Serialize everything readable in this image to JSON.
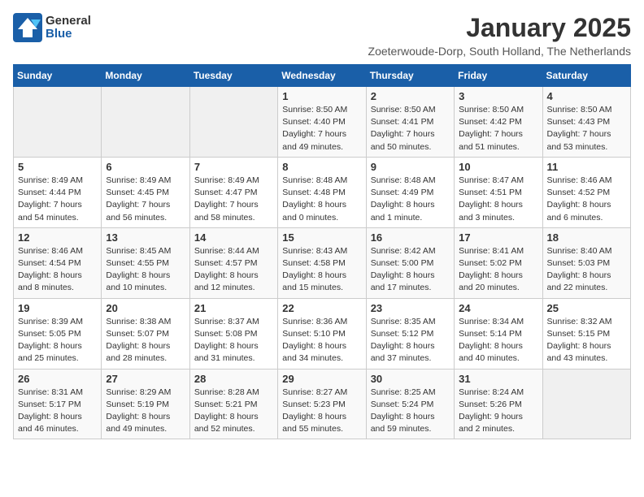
{
  "logo": {
    "general": "General",
    "blue": "Blue"
  },
  "title": "January 2025",
  "location": "Zoeterwoude-Dorp, South Holland, The Netherlands",
  "weekdays": [
    "Sunday",
    "Monday",
    "Tuesday",
    "Wednesday",
    "Thursday",
    "Friday",
    "Saturday"
  ],
  "weeks": [
    [
      {
        "day": "",
        "info": ""
      },
      {
        "day": "",
        "info": ""
      },
      {
        "day": "",
        "info": ""
      },
      {
        "day": "1",
        "info": "Sunrise: 8:50 AM\nSunset: 4:40 PM\nDaylight: 7 hours and 49 minutes."
      },
      {
        "day": "2",
        "info": "Sunrise: 8:50 AM\nSunset: 4:41 PM\nDaylight: 7 hours and 50 minutes."
      },
      {
        "day": "3",
        "info": "Sunrise: 8:50 AM\nSunset: 4:42 PM\nDaylight: 7 hours and 51 minutes."
      },
      {
        "day": "4",
        "info": "Sunrise: 8:50 AM\nSunset: 4:43 PM\nDaylight: 7 hours and 53 minutes."
      }
    ],
    [
      {
        "day": "5",
        "info": "Sunrise: 8:49 AM\nSunset: 4:44 PM\nDaylight: 7 hours and 54 minutes."
      },
      {
        "day": "6",
        "info": "Sunrise: 8:49 AM\nSunset: 4:45 PM\nDaylight: 7 hours and 56 minutes."
      },
      {
        "day": "7",
        "info": "Sunrise: 8:49 AM\nSunset: 4:47 PM\nDaylight: 7 hours and 58 minutes."
      },
      {
        "day": "8",
        "info": "Sunrise: 8:48 AM\nSunset: 4:48 PM\nDaylight: 8 hours and 0 minutes."
      },
      {
        "day": "9",
        "info": "Sunrise: 8:48 AM\nSunset: 4:49 PM\nDaylight: 8 hours and 1 minute."
      },
      {
        "day": "10",
        "info": "Sunrise: 8:47 AM\nSunset: 4:51 PM\nDaylight: 8 hours and 3 minutes."
      },
      {
        "day": "11",
        "info": "Sunrise: 8:46 AM\nSunset: 4:52 PM\nDaylight: 8 hours and 6 minutes."
      }
    ],
    [
      {
        "day": "12",
        "info": "Sunrise: 8:46 AM\nSunset: 4:54 PM\nDaylight: 8 hours and 8 minutes."
      },
      {
        "day": "13",
        "info": "Sunrise: 8:45 AM\nSunset: 4:55 PM\nDaylight: 8 hours and 10 minutes."
      },
      {
        "day": "14",
        "info": "Sunrise: 8:44 AM\nSunset: 4:57 PM\nDaylight: 8 hours and 12 minutes."
      },
      {
        "day": "15",
        "info": "Sunrise: 8:43 AM\nSunset: 4:58 PM\nDaylight: 8 hours and 15 minutes."
      },
      {
        "day": "16",
        "info": "Sunrise: 8:42 AM\nSunset: 5:00 PM\nDaylight: 8 hours and 17 minutes."
      },
      {
        "day": "17",
        "info": "Sunrise: 8:41 AM\nSunset: 5:02 PM\nDaylight: 8 hours and 20 minutes."
      },
      {
        "day": "18",
        "info": "Sunrise: 8:40 AM\nSunset: 5:03 PM\nDaylight: 8 hours and 22 minutes."
      }
    ],
    [
      {
        "day": "19",
        "info": "Sunrise: 8:39 AM\nSunset: 5:05 PM\nDaylight: 8 hours and 25 minutes."
      },
      {
        "day": "20",
        "info": "Sunrise: 8:38 AM\nSunset: 5:07 PM\nDaylight: 8 hours and 28 minutes."
      },
      {
        "day": "21",
        "info": "Sunrise: 8:37 AM\nSunset: 5:08 PM\nDaylight: 8 hours and 31 minutes."
      },
      {
        "day": "22",
        "info": "Sunrise: 8:36 AM\nSunset: 5:10 PM\nDaylight: 8 hours and 34 minutes."
      },
      {
        "day": "23",
        "info": "Sunrise: 8:35 AM\nSunset: 5:12 PM\nDaylight: 8 hours and 37 minutes."
      },
      {
        "day": "24",
        "info": "Sunrise: 8:34 AM\nSunset: 5:14 PM\nDaylight: 8 hours and 40 minutes."
      },
      {
        "day": "25",
        "info": "Sunrise: 8:32 AM\nSunset: 5:15 PM\nDaylight: 8 hours and 43 minutes."
      }
    ],
    [
      {
        "day": "26",
        "info": "Sunrise: 8:31 AM\nSunset: 5:17 PM\nDaylight: 8 hours and 46 minutes."
      },
      {
        "day": "27",
        "info": "Sunrise: 8:29 AM\nSunset: 5:19 PM\nDaylight: 8 hours and 49 minutes."
      },
      {
        "day": "28",
        "info": "Sunrise: 8:28 AM\nSunset: 5:21 PM\nDaylight: 8 hours and 52 minutes."
      },
      {
        "day": "29",
        "info": "Sunrise: 8:27 AM\nSunset: 5:23 PM\nDaylight: 8 hours and 55 minutes."
      },
      {
        "day": "30",
        "info": "Sunrise: 8:25 AM\nSunset: 5:24 PM\nDaylight: 8 hours and 59 minutes."
      },
      {
        "day": "31",
        "info": "Sunrise: 8:24 AM\nSunset: 5:26 PM\nDaylight: 9 hours and 2 minutes."
      },
      {
        "day": "",
        "info": ""
      }
    ]
  ]
}
